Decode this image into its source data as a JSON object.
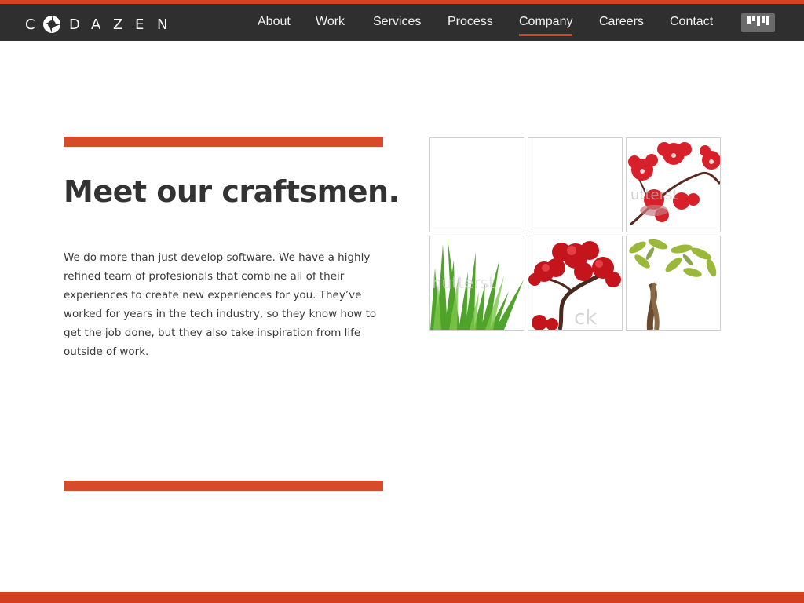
{
  "brand": {
    "name": "CODAZEN",
    "accent": "#d84022",
    "nav_bg": "#2f2f2f"
  },
  "nav": {
    "items": [
      {
        "label": "About"
      },
      {
        "label": "Work"
      },
      {
        "label": "Services"
      },
      {
        "label": "Process"
      },
      {
        "label": "Company",
        "active": true
      },
      {
        "label": "Careers"
      },
      {
        "label": "Contact"
      }
    ],
    "menu_icon": "bars-menu-icon"
  },
  "hero": {
    "title": "Meet our craftsmen.",
    "body": "We do more than just develop software. We have a highly refined team of profesionals that combine all of their experiences to create new experiences for you.  They’ve worked for years in the tech industry, so they know how to get the job done, but they also take inspiration from life outside of work."
  },
  "gallery": {
    "tiles": [
      {
        "name": "empty-tile-1",
        "icon": "blank"
      },
      {
        "name": "empty-tile-2",
        "icon": "blank"
      },
      {
        "name": "red-orchid-image",
        "icon": "orchid",
        "watermark": "shutterstock"
      },
      {
        "name": "green-grass-image",
        "icon": "grass",
        "watermark": "shutterstock"
      },
      {
        "name": "red-bonsai-tree-image",
        "icon": "bonsai",
        "watermark": "stock"
      },
      {
        "name": "money-tree-plant-image",
        "icon": "money-tree"
      }
    ]
  }
}
